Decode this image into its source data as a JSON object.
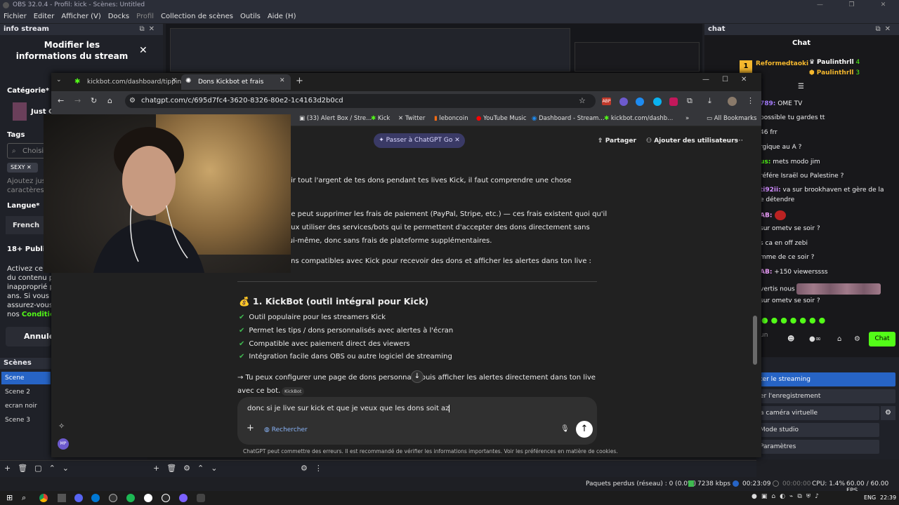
{
  "obs": {
    "title": "OBS 32.0.4 - Profil: kick - Scènes: Untitled",
    "menu": [
      "Fichier",
      "Editer",
      "Afficher (V)",
      "Docks",
      "Profil",
      "Collection de scènes",
      "Outils",
      "Aide (H)"
    ],
    "info_panel": {
      "header": "info stream",
      "modal_title": "Modifier les informations du stream",
      "category_label": "Catégorie*",
      "category_value": "Just C",
      "tags_label": "Tags",
      "tags_placeholder": "Choisi",
      "tag_chip": "SEXY",
      "tags_help_1": "Ajoutez jusc",
      "tags_help_2": "caractères,",
      "language_label": "Langue*",
      "language_value": "French",
      "public_label": "18+ Public",
      "warning_lines": [
        "Activez ce",
        "du contenu po",
        "inapproprié po",
        "ans. Si vous d",
        "assurez-vous"
      ],
      "conditions_prefix": "nos ",
      "conditions_link": "Condition",
      "cancel_label": "Annule"
    },
    "chat_panel": {
      "header": "chat",
      "title": "Chat",
      "top_user": "Reformedtaoki",
      "badge_users": [
        {
          "name": "Paulinthrll",
          "count": "4"
        },
        {
          "name": "Paulinthrll",
          "count": "3"
        }
      ],
      "messages": [
        {
          "user": "789:",
          "text": " OME TV"
        },
        {
          "user": "",
          "text": "possible tu gardes tt"
        },
        {
          "user": "",
          "text": "46 frr"
        },
        {
          "user": "",
          "text": "rgique au A ?"
        },
        {
          "user": "us:",
          "text": " mets modo jim"
        },
        {
          "user": "",
          "text": "référe Israël ou Palestine ?"
        },
        {
          "user": "ti92ii:",
          "text": " va sur brookhaven et gère de la"
        },
        {
          "user": "",
          "text": "e détendre"
        },
        {
          "user": "AB:",
          "text": ""
        },
        {
          "user": "",
          "text": "sur ometv se soir ?"
        },
        {
          "user": "",
          "text": "s ca en off zebi"
        },
        {
          "user": "",
          "text": "mme de ce soir ?"
        },
        {
          "user": "AB:",
          "text": " +150 viewerssss"
        },
        {
          "user": "",
          "text": "vertis nous"
        },
        {
          "user": "",
          "text": "sur ometv se soir ?"
        }
      ],
      "input_placeholder": "un",
      "chat_button": "Chat"
    },
    "scenes": {
      "header": "Scènes",
      "items": [
        "Scene",
        "Scene 2",
        "ecran noir",
        "Scene 3"
      ],
      "active": "Scene"
    },
    "controls": {
      "items": [
        "ter le streaming",
        "er l'enregistrement",
        "a caméra virtuelle",
        "Mode studio",
        "Paramètres"
      ]
    },
    "status": {
      "dropped": "Paquets perdus (réseau) : 0 (0.0%)",
      "bitrate": "7238 kbps",
      "stream_time": "00:23:09",
      "rec_time": "00:00:00",
      "cpu": "CPU: 1.4%",
      "fps": "60.00 / 60.00 FPS"
    }
  },
  "browser": {
    "tabs": [
      {
        "title": "kickbot.com/dashboard/tipping",
        "active": false
      },
      {
        "title": "Dons Kickbot et frais",
        "active": true
      }
    ],
    "url": "chatgpt.com/c/695d7fc4-3620-8326-80e2-1c4163d2b0cd",
    "bookmarks": [
      "(33) Alert Box / Stre...",
      "Kick",
      "Twitter",
      "leboncoin",
      "YouTube Music",
      "Dashboard - Stream...",
      "kickbot.com/dashb..."
    ],
    "all_bookmarks": "All Bookmarks",
    "chatgpt": {
      "go_button": "Passer à ChatGPT Go",
      "share": "Partager",
      "add_users": "Ajouter des utilisateurs",
      "para1": "oir tout l'argent de tes dons pendant tes lives Kick, il faut comprendre une chose",
      "para2_a": "ne peut supprimer les frais de paiement (PayPal, Stripe, etc.) — ces frais existent quoi qu'il",
      "para2_b": "eux utiliser des services/bots qui te permettent d'accepter des dons directement sans",
      "para2_c": "lui-même, donc sans frais de plateforme supplémentaires.",
      "para3": "ons compatibles avec Kick pour recevoir des dons et afficher les alertes dans ton live :",
      "section_title": "💰 1. KickBot (outil intégral pour Kick)",
      "bullets": [
        "Outil populaire pour les streamers Kick",
        "Permet les tips / dons personnalisés avec alertes à l'écran",
        "Compatible avec paiement direct des viewers",
        "Intégration facile dans OBS ou autre logiciel de streaming"
      ],
      "config_line_1": "→ Tu peux configurer une page de dons personnalis    puis afficher les alertes directement dans ton live",
      "config_line_2": "avec ce bot.",
      "source_chip": "KickBot",
      "input_text": "donc si je live sur kick et que je veux que les dons soit az",
      "search_label": "Rechercher",
      "disclaimer": "ChatGPT peut commettre des erreurs. Il est recommandé de vérifier les informations importantes. Voir les préférences en matière de cookies."
    }
  },
  "taskbar": {
    "lang": "ENG",
    "time": "22:39"
  }
}
